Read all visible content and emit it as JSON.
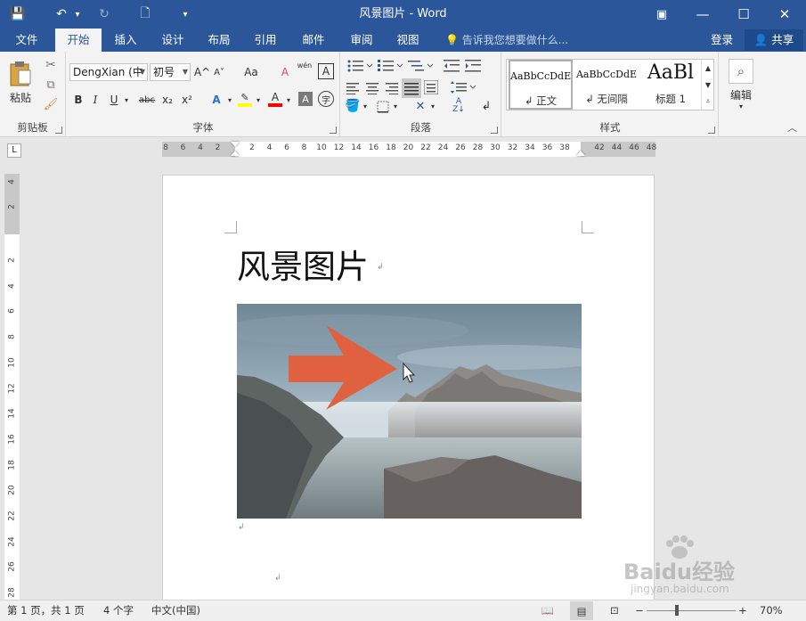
{
  "window": {
    "title": "风景图片 - Word",
    "buttons": {
      "ribbon_display": "▣",
      "minimize": "—",
      "maximize": "☐",
      "close": "✕"
    }
  },
  "quick_access": {
    "save": "💾",
    "undo": "↶",
    "undo_dropdown": "▾",
    "redo": "↻",
    "new": "🗋",
    "customize": "▾"
  },
  "tabs": [
    "文件",
    "开始",
    "插入",
    "设计",
    "布局",
    "引用",
    "邮件",
    "审阅",
    "视图"
  ],
  "active_tab": "开始",
  "tell_me": "告诉我您想要做什么...",
  "sign_in": "登录",
  "share": "共享",
  "clipboard": {
    "paste": "粘贴",
    "group_label": "剪贴板"
  },
  "font": {
    "name": "DengXian (中",
    "size": "初号",
    "group_label": "字体",
    "bold": "B",
    "italic": "I",
    "underline": "U",
    "strike": "abc",
    "subscript": "x₂",
    "superscript": "x²",
    "grow": "A^",
    "shrink": "A˅",
    "case": "Aa",
    "clear": "A",
    "phonetic": "wén",
    "border": "A",
    "shade": "A",
    "circle": "字"
  },
  "paragraph": {
    "group_label": "段落"
  },
  "styles": {
    "group_label": "样式",
    "items": [
      {
        "sample": "AaBbCcDdE",
        "name": "↲ 正文"
      },
      {
        "sample": "AaBbCcDdE",
        "name": "↲ 无间隔"
      },
      {
        "sample": "AaBl",
        "name": "标题 1"
      }
    ]
  },
  "editing": {
    "label": "编辑"
  },
  "ruler": {
    "h_left": [
      "8",
      "6",
      "4",
      "2"
    ],
    "h_right": [
      "2",
      "4",
      "6",
      "8",
      "10",
      "12",
      "14",
      "16",
      "18",
      "20",
      "22",
      "24",
      "26",
      "28",
      "30",
      "32",
      "34",
      "36",
      "38",
      "42",
      "44",
      "46",
      "48"
    ],
    "v_top": [
      "4",
      "2"
    ],
    "v_main": [
      "2",
      "4",
      "6",
      "8",
      "10",
      "12",
      "14",
      "16",
      "18",
      "20",
      "22",
      "24",
      "26",
      "28"
    ]
  },
  "document": {
    "title": "风景图片",
    "paragraph_mark": "↲"
  },
  "status": {
    "pages": "第 1 页，共 1 页",
    "words": "4 个字",
    "language": "中文(中国)",
    "zoom": "70%",
    "zoom_out": "−",
    "zoom_in": "+"
  },
  "watermark": {
    "brand": "Baidu经验",
    "url": "jingyan.baidu.com"
  },
  "colors": {
    "brand": "#2b579a",
    "arrow": "#e0613f",
    "highlight": "#ffff00",
    "font_color": "#ff0000"
  }
}
